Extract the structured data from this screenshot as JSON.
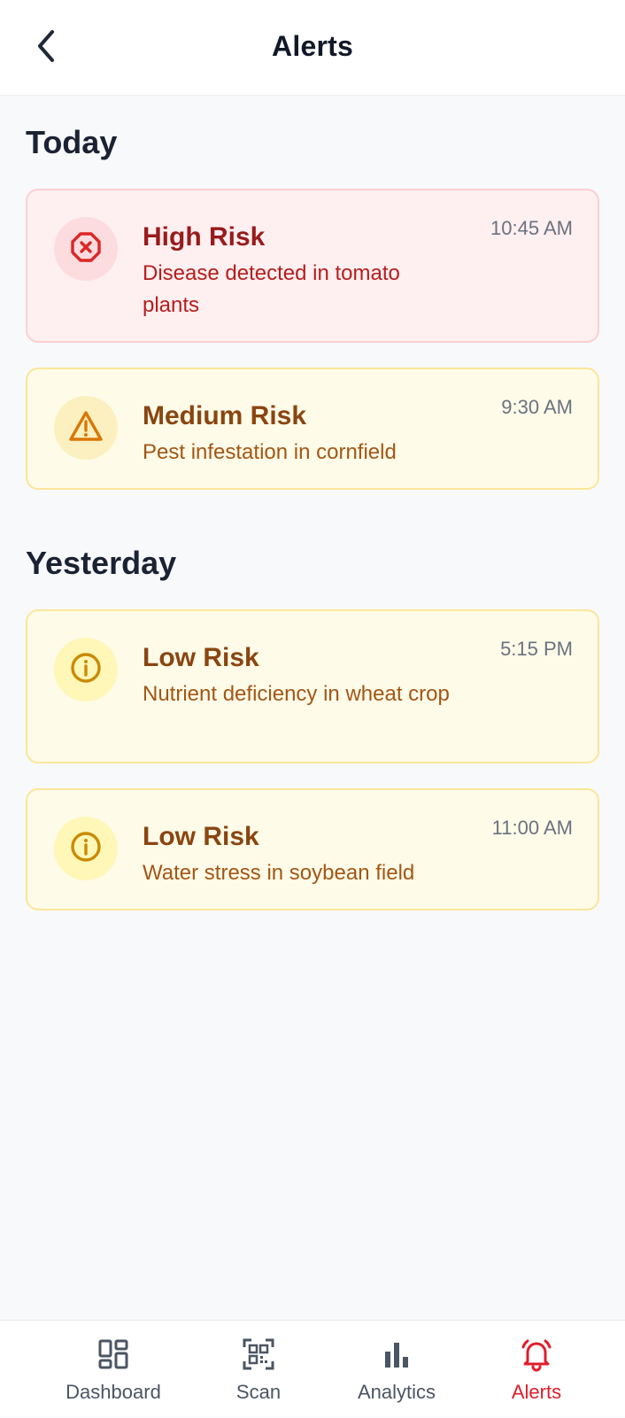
{
  "header": {
    "title": "Alerts",
    "back_icon": "chevron-left-icon"
  },
  "sections": [
    {
      "title": "Today",
      "alerts": [
        {
          "level": "high",
          "title": "High Risk",
          "description": "Disease detected in tomato plants",
          "time": "10:45 AM",
          "icon": "x-octagon-icon",
          "color": "#dc2626"
        },
        {
          "level": "medium",
          "title": "Medium Risk",
          "description": "Pest infestation in cornfield",
          "time": "9:30 AM",
          "icon": "warning-triangle-icon",
          "color": "#d97706"
        }
      ]
    },
    {
      "title": "Yesterday",
      "alerts": [
        {
          "level": "low",
          "title": "Low Risk",
          "description": "Nutrient deficiency in wheat crop",
          "time": "5:15 PM",
          "icon": "info-circle-icon",
          "color": "#ca8a04"
        },
        {
          "level": "low",
          "title": "Low Risk",
          "description": "Water stress in soybean field",
          "time": "11:00 AM",
          "icon": "info-circle-icon",
          "color": "#ca8a04"
        }
      ]
    }
  ],
  "bottom_nav": [
    {
      "label": "Dashboard",
      "icon": "dashboard-grid-icon",
      "active": false
    },
    {
      "label": "Scan",
      "icon": "qr-scan-icon",
      "active": false
    },
    {
      "label": "Analytics",
      "icon": "bar-chart-icon",
      "active": false
    },
    {
      "label": "Alerts",
      "icon": "bell-icon",
      "active": true
    }
  ],
  "colors": {
    "active_nav": "#e11d2a",
    "inactive_nav": "#4b5563"
  }
}
